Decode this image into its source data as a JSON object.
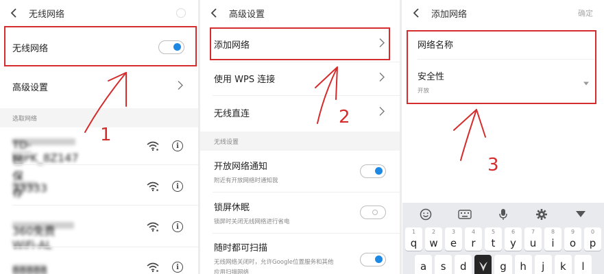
{
  "colors": {
    "accent": "#1e88e5",
    "annotation": "#d42c2c",
    "section_bg": "#f4f4f4"
  },
  "panel1": {
    "title": "无线网络",
    "wifi_row": {
      "label": "无线网络",
      "toggle_on": true
    },
    "advanced_row": {
      "label": "高级设置"
    },
    "section_label": "选取网络",
    "networks": [
      {
        "ssid": "TD-NIPK_8Z147",
        "sub": "已保存"
      },
      {
        "ssid": "33333",
        "sub": ""
      },
      {
        "ssid": "360免费WiFi-AL",
        "sub": ""
      },
      {
        "ssid": "88888",
        "sub": ""
      }
    ],
    "callout": "1"
  },
  "panel2": {
    "title": "高级设置",
    "rows": [
      {
        "label": "添加网络"
      },
      {
        "label": "使用 WPS 连接"
      },
      {
        "label": "无线直连"
      }
    ],
    "section_label": "无线设置",
    "settings": [
      {
        "label": "开放网络通知",
        "sub": "附近有开放网络时通知我",
        "toggle_on": true
      },
      {
        "label": "锁屏休眠",
        "sub": "锁屏时关闭无线网络进行省电",
        "toggle_on": false
      },
      {
        "label": "随时都可扫描",
        "sub": "无线网络关闭时，允许Google位置服务和其他",
        "sub2": "应用扫描网络",
        "toggle_on": true
      }
    ],
    "callout": "2"
  },
  "panel3": {
    "title": "添加网络",
    "confirm": "确定",
    "name_label": "网络名称",
    "security_label": "安全性",
    "security_value": "开放",
    "callout": "3",
    "keyboard": {
      "toolbar_icons": [
        "emoji-icon",
        "keyboard-icon",
        "mic-icon",
        "gear-icon",
        "collapse-icon"
      ],
      "row1": [
        {
          "ch": "q",
          "num": "1"
        },
        {
          "ch": "w",
          "num": "2"
        },
        {
          "ch": "e",
          "num": "3"
        },
        {
          "ch": "r",
          "num": "4"
        },
        {
          "ch": "t",
          "num": "5"
        },
        {
          "ch": "y",
          "num": "6"
        },
        {
          "ch": "u",
          "num": "7"
        },
        {
          "ch": "i",
          "num": "8"
        },
        {
          "ch": "o",
          "num": "9"
        },
        {
          "ch": "p",
          "num": "0"
        }
      ],
      "row2": [
        "a",
        "s",
        "d",
        "",
        "g",
        "h",
        "j",
        "k",
        "l"
      ]
    }
  }
}
